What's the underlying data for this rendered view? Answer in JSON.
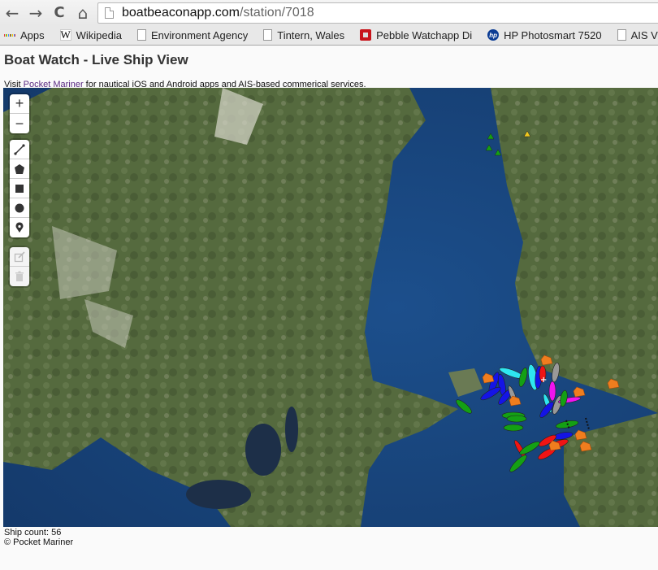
{
  "browser": {
    "nav": {
      "back": "←",
      "forward": "→",
      "reload": "C",
      "home": "⌂"
    },
    "url": {
      "host": "boatbeaconapp.com",
      "path": "/station/7018"
    },
    "bookmarks": [
      {
        "label": "Apps",
        "icon": "apps-grid-icon"
      },
      {
        "label": "Wikipedia",
        "icon": "wikipedia-icon"
      },
      {
        "label": "Environment Agency",
        "icon": "document-icon"
      },
      {
        "label": "Tintern, Wales",
        "icon": "document-icon"
      },
      {
        "label": "Pebble Watchapp Di",
        "icon": "pebble-icon"
      },
      {
        "label": "HP Photosmart 7520",
        "icon": "hp-icon"
      },
      {
        "label": "AIS VDM &",
        "icon": "document-icon"
      }
    ]
  },
  "page": {
    "title": "Boat Watch - Live Ship View",
    "visit_prefix": "Visit ",
    "visit_link": "Pocket Mariner",
    "visit_suffix": " for nautical iOS and Android apps and AIS-based commerical services."
  },
  "map": {
    "zoom_in": "+",
    "zoom_out": "−",
    "draw_tools": [
      "draw-polyline",
      "draw-polygon",
      "draw-rectangle",
      "draw-circle",
      "draw-marker"
    ],
    "edit_tools": [
      "edit-layers",
      "delete-layers"
    ],
    "ship_colors": {
      "blue": "#1414e6",
      "cyan": "#2ee6f0",
      "green": "#14a014",
      "red": "#f01414",
      "magenta": "#f014f0",
      "grey": "#999999",
      "orange": "#f07d1e",
      "yellow": "#f0c81e"
    }
  },
  "footer": {
    "ship_count_label": "Ship count: 56",
    "copyright": "© Pocket Mariner"
  }
}
